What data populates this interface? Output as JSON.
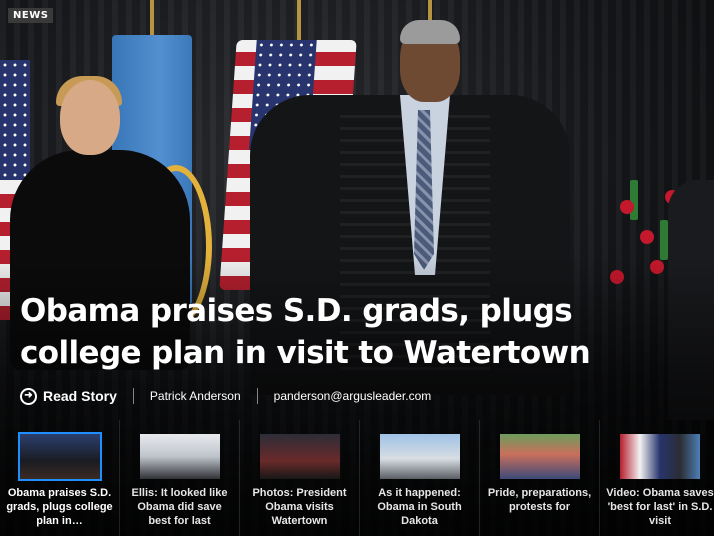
{
  "section": {
    "badge": "NEWS"
  },
  "story": {
    "headline": "Obama praises S.D. grads, plugs college plan in visit to Watertown",
    "read_label": "Read Story",
    "read_icon": "arrow-circle-icon",
    "author": "Patrick Anderson",
    "email": "panderson@argusleader.com"
  },
  "related": [
    {
      "caption": "Obama praises S.D. grads, plugs college plan in…",
      "active": true
    },
    {
      "caption": "Ellis: It looked like Obama did save best for last",
      "active": false
    },
    {
      "caption": "Photos: President Obama visits Watertown",
      "active": false
    },
    {
      "caption": "As it happened: Obama in South Dakota",
      "active": false
    },
    {
      "caption": "Pride, preparations, protests for",
      "active": false
    },
    {
      "caption": "Video: Obama saves 'best for last' in S.D. visit",
      "active": false
    }
  ],
  "colors": {
    "active_outline": "#1f8fff",
    "badge_bg": "#3a3a3a"
  }
}
